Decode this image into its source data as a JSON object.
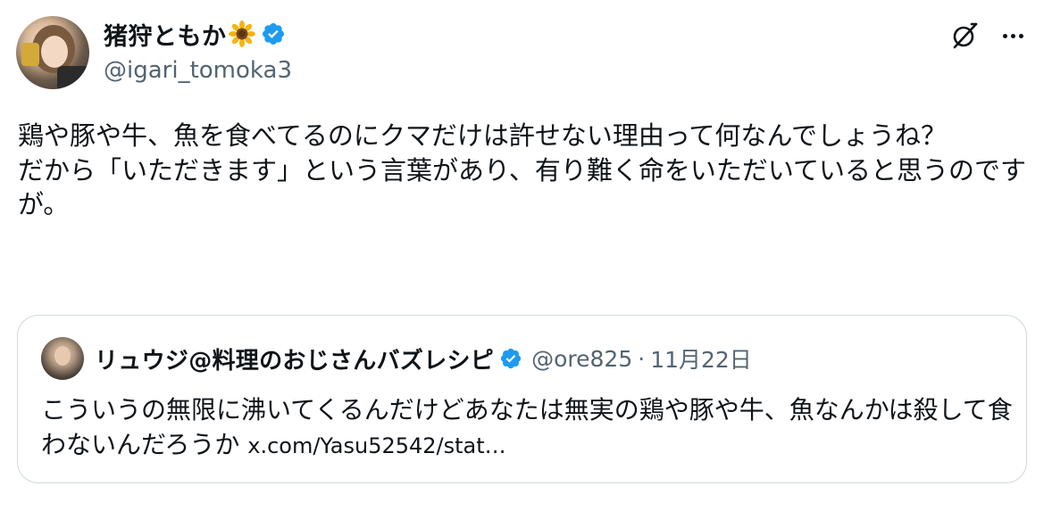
{
  "author": {
    "display_name": "猪狩ともか",
    "handle": "@igari_tomoka3",
    "emoji_icon": "sunflower-icon",
    "verified_color": "#1d9bf0"
  },
  "tweet": {
    "text_line_1": "鶏や豚や牛、魚を食べてるのにクマだけは許せない理由って何なんでしょうね？",
    "text_line_2": "だから「いただきます」という言葉があり、有り難く命をいただいていると思うのですが。"
  },
  "quote": {
    "display_name": "リュウジ@料理のおじさんバズレシピ",
    "handle": "@ore825",
    "separator": "·",
    "date": "11月22日",
    "text": "こういうの無限に沸いてくるんだけどあなたは無実の鶏や豚や牛、魚なんかは殺して食わないんだろうか ",
    "link_text": "x.com/Yasu52542/stat…"
  },
  "icons": {
    "grok": "grok-icon",
    "more": "more-options-icon",
    "verified": "verified-badge-icon"
  },
  "colors": {
    "text_primary": "#0f1419",
    "text_secondary": "#536471",
    "border": "#cfd9de",
    "verified_blue": "#1d9bf0"
  }
}
